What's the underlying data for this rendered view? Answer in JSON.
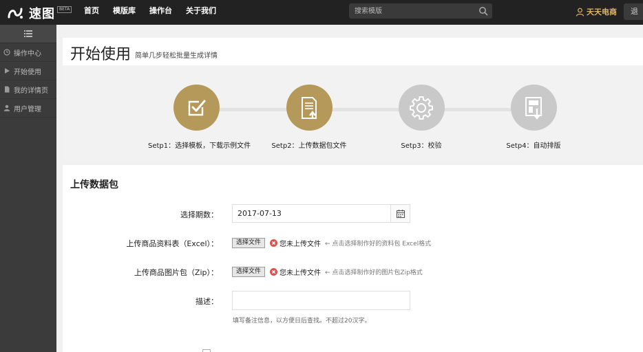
{
  "brand": {
    "name": "速图",
    "badge": "BETA"
  },
  "nav": [
    "首页",
    "模版库",
    "操作台",
    "关于我们"
  ],
  "search": {
    "placeholder": "搜索模版"
  },
  "user": {
    "name": "天天电商"
  },
  "top_right_button": "退",
  "sidebar": {
    "items": [
      {
        "label": "操作中心",
        "icon": "clock-icon"
      },
      {
        "label": "开始使用",
        "icon": "play-icon"
      },
      {
        "label": "我的详情页",
        "icon": "document-icon"
      },
      {
        "label": "用户管理",
        "icon": "user-icon"
      }
    ]
  },
  "page": {
    "title": "开始使用",
    "subtitle": "简单几步轻松批量生成详情"
  },
  "steps": [
    {
      "label": "Setp1：选择模板，下载示例文件",
      "state": "active",
      "icon": "checkbox-icon"
    },
    {
      "label": "Setp2：上传数据包文件",
      "state": "active",
      "icon": "upload-document-icon"
    },
    {
      "label": "Setp3：校验",
      "state": "inactive",
      "icon": "gear-icon"
    },
    {
      "label": "Setp4：自动排版",
      "state": "inactive",
      "icon": "layout-download-icon"
    }
  ],
  "colors": {
    "accent": "#b4995a",
    "inactive": "#c9c9c9",
    "topbar": "#222222",
    "sidebar": "#3b3b3b",
    "user": "#e0b565",
    "error": "#d9534f"
  },
  "form": {
    "section_title": "上传数据包",
    "date": {
      "label": "选择期数：",
      "value": "2017-07-13"
    },
    "excel": {
      "label": "上传商品资料表（Excel）：",
      "button": "选择文件",
      "status": "您未上传文件",
      "hint": "← 点击选择制作好的资料包 Excel格式"
    },
    "zip": {
      "label": "上传商品图片包（Zip）：",
      "button": "选择文件",
      "status": "您未上传文件",
      "hint": "← 点击选择制作好的图片包Zip格式"
    },
    "desc": {
      "label": "描述：",
      "value": "",
      "hint": "填写备注信息，以方便日后查找。不超过20汉字。"
    }
  }
}
